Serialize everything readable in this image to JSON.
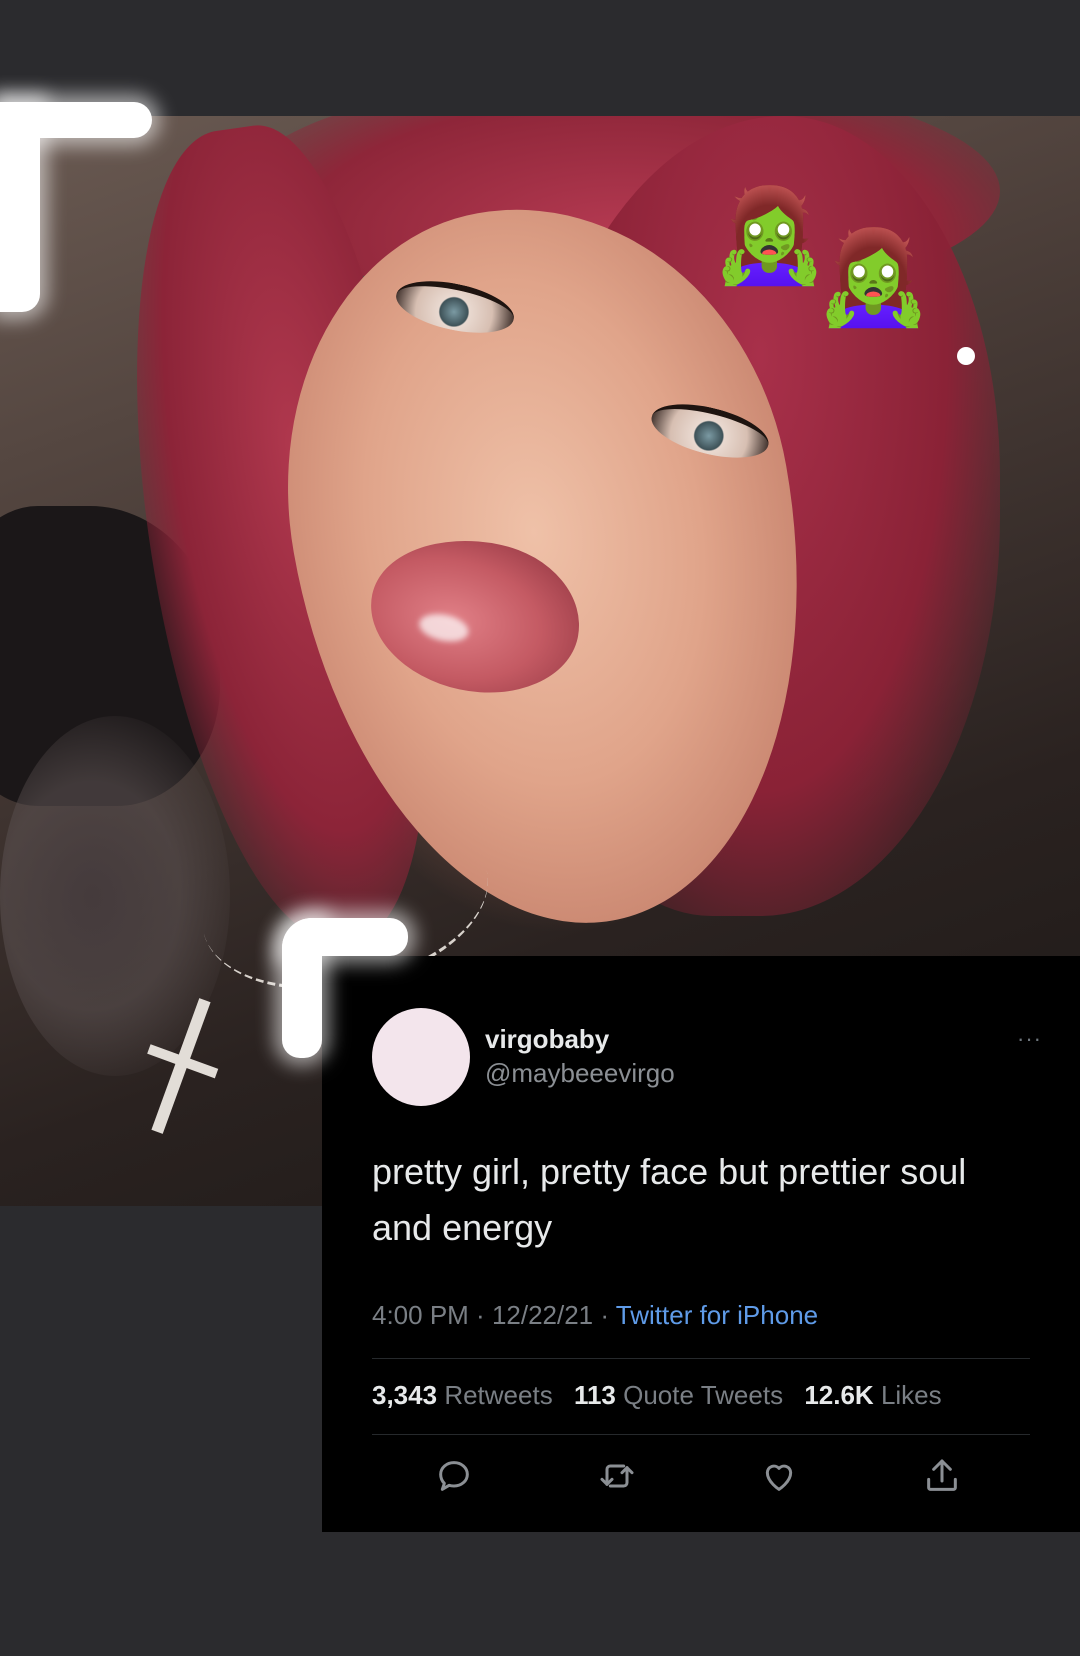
{
  "photo": {
    "stickers": [
      "🧟‍♀️",
      "🧟‍♀️"
    ]
  },
  "tweet": {
    "display_name": "virgobaby",
    "handle": "@maybeeevirgo",
    "more": "···",
    "text": "pretty girl, pretty face but prettier soul and energy",
    "time": "4:00 PM",
    "dot1": " · ",
    "date": "12/22/21",
    "dot2": " · ",
    "source": "Twitter for iPhone",
    "stats": {
      "retweets_count": "3,343",
      "retweets_label": "Retweets",
      "quotes_count": "113",
      "quotes_label": "Quote Tweets",
      "likes_count": "12.6K",
      "likes_label": "Likes"
    },
    "actions": [
      "reply-icon",
      "retweet-icon",
      "like-icon",
      "share-icon"
    ]
  },
  "colors": {
    "background": "#2b2b2e",
    "card": "#000000",
    "link": "#5f9be8",
    "muted": "#7a7f85",
    "avatar": "#f3e5ec"
  }
}
